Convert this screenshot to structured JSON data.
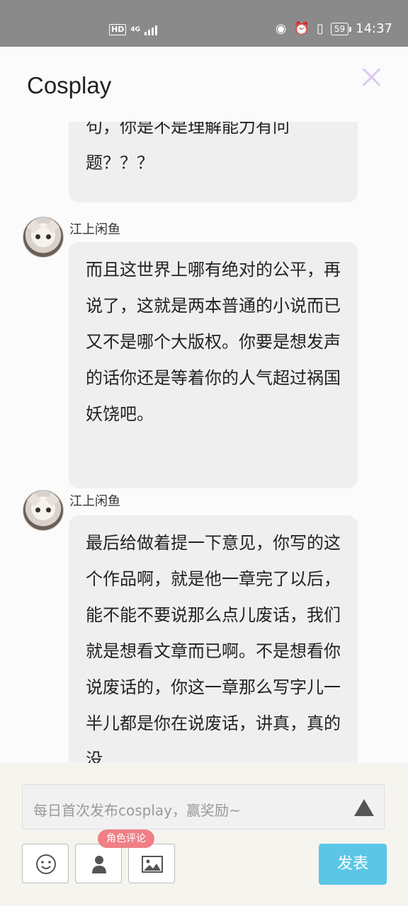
{
  "status_bar": {
    "hd_label": "HD",
    "network_label": "4G",
    "battery": "59",
    "time": "14:37"
  },
  "header": {
    "title": "Cosplay"
  },
  "comments": [
    {
      "text": "句，你是不是理解能力有问题？？？"
    },
    {
      "author": "江上闲鱼",
      "text": "而且这世界上哪有绝对的公平，再说了，这就是两本普通的小说而已又不是哪个大版权。你要是想发声的话你还是等着你的人气超过祸国妖饶吧。"
    },
    {
      "author": "江上闲鱼",
      "text": "最后给做着提一下意见，你写的这个作品啊，就是他一章完了以后，能不能不要说那么点儿废话，我们就是想看文章而已啊。不是想看你说废话的，你这一章那么写字儿一半儿都是你在说废话，讲真，真的没"
    }
  ],
  "composer": {
    "placeholder": "每日首次发布cosplay，赢奖励~",
    "role_badge": "角色评论",
    "publish_label": "发表"
  },
  "colors": {
    "publish": "#5cc6e6",
    "badge": "#f07f86",
    "close": "#d9c9ee"
  }
}
